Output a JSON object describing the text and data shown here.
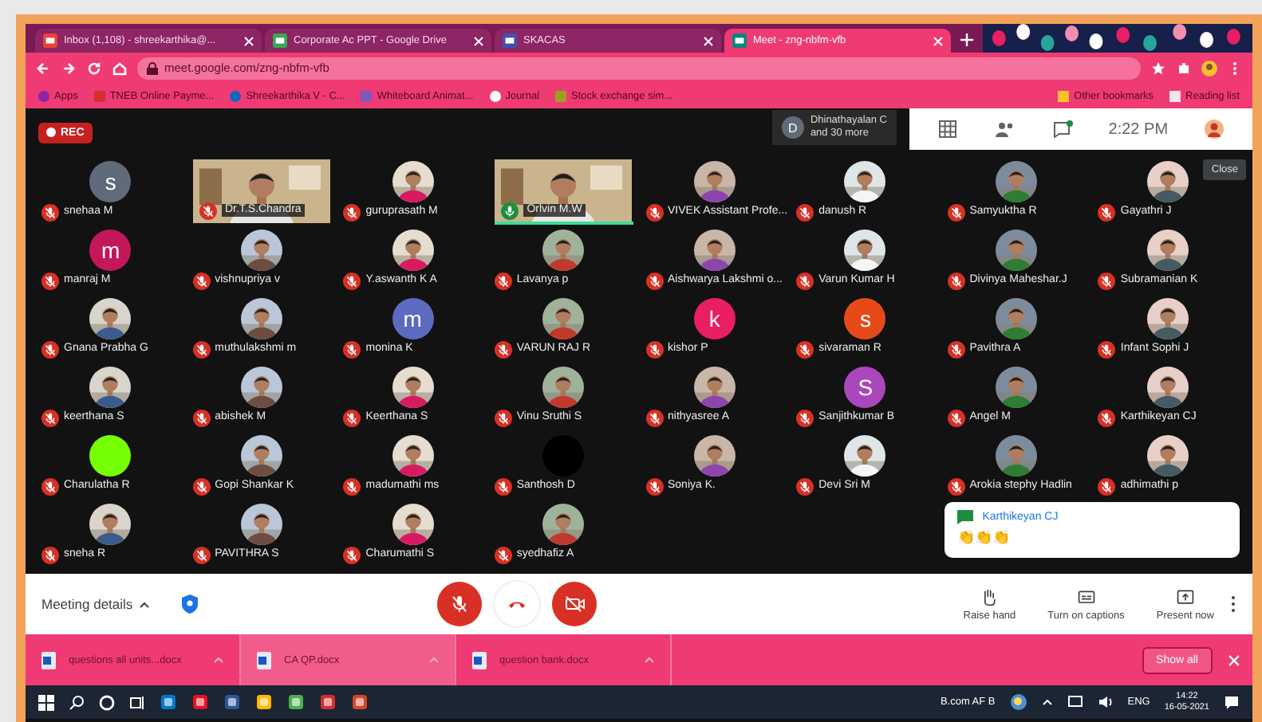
{
  "browser": {
    "tabs": [
      {
        "title": "Inbox (1,108) - shreekarthika@...",
        "selected": false
      },
      {
        "title": "Corporate Ac PPT - Google Drive",
        "selected": false
      },
      {
        "title": "SKACAS",
        "selected": false
      },
      {
        "title": "Meet - zng-nbfm-vfb",
        "selected": true
      }
    ],
    "address": "meet.google.com/zng-nbfm-vfb",
    "bookmarks": [
      "Apps",
      "TNEB Online Payme...",
      "Shreekarthika V - C...",
      "Whiteboard Animat...",
      "Journal",
      "Stock exchange sim..."
    ],
    "bookmarks_right": [
      "Other bookmarks",
      "Reading list"
    ]
  },
  "meeting": {
    "recording_badge": "REC",
    "presenter": {
      "initial": "D",
      "name": "Dhinathayalan C",
      "more": "and 30 more"
    },
    "time": "2:22 PM",
    "tooltip": "Close",
    "participants": [
      {
        "name": "snehaa M",
        "kind": "letter",
        "letter": "s",
        "color": "#5f6b78",
        "muted": true,
        "speaking": false
      },
      {
        "name": "Dr.T.S.Chandra",
        "kind": "video",
        "muted": true,
        "speaking": false
      },
      {
        "name": "guruprasath M",
        "kind": "picture",
        "muted": true,
        "speaking": false
      },
      {
        "name": "Orlvin M.W",
        "kind": "video",
        "muted": false,
        "speaking": true
      },
      {
        "name": "VIVEK Assistant Profe...",
        "kind": "picture",
        "muted": true,
        "speaking": false
      },
      {
        "name": "danush R",
        "kind": "picture",
        "muted": true,
        "speaking": false
      },
      {
        "name": "Samyuktha R",
        "kind": "picture",
        "muted": true,
        "speaking": false
      },
      {
        "name": "Gayathri J",
        "kind": "picture",
        "muted": true,
        "speaking": false
      },
      {
        "name": "manraj M",
        "kind": "letter",
        "letter": "m",
        "color": "#c2185b",
        "muted": true,
        "speaking": false
      },
      {
        "name": "vishnupriya v",
        "kind": "picture",
        "muted": true,
        "speaking": false
      },
      {
        "name": "Y.aswanth K A",
        "kind": "picture",
        "muted": true,
        "speaking": false
      },
      {
        "name": "Lavanya p",
        "kind": "picture",
        "muted": true,
        "speaking": false
      },
      {
        "name": "Aishwarya Lakshmi o...",
        "kind": "picture",
        "muted": true,
        "speaking": false
      },
      {
        "name": "Varun Kumar H",
        "kind": "picture",
        "muted": true,
        "speaking": false
      },
      {
        "name": "Divinya Maheshar.J",
        "kind": "picture",
        "muted": true,
        "speaking": false
      },
      {
        "name": "Subramanian K",
        "kind": "picture",
        "muted": true,
        "speaking": false
      },
      {
        "name": "Gnana Prabha G",
        "kind": "picture",
        "muted": true,
        "speaking": false
      },
      {
        "name": "muthulakshmi m",
        "kind": "picture",
        "muted": true,
        "speaking": false
      },
      {
        "name": "monina K",
        "kind": "letter",
        "letter": "m",
        "color": "#5c6bc0",
        "muted": true,
        "speaking": false
      },
      {
        "name": "VARUN RAJ R",
        "kind": "picture",
        "muted": true,
        "speaking": false
      },
      {
        "name": "kishor P",
        "kind": "letter",
        "letter": "k",
        "color": "#e91e63",
        "muted": true,
        "speaking": false
      },
      {
        "name": "sivaraman R",
        "kind": "letter",
        "letter": "s",
        "color": "#e64a19",
        "muted": true,
        "speaking": false
      },
      {
        "name": "Pavithra A",
        "kind": "picture",
        "muted": true,
        "speaking": false
      },
      {
        "name": "Infant Sophi J",
        "kind": "picture",
        "muted": true,
        "speaking": false
      },
      {
        "name": "keerthana S",
        "kind": "picture",
        "muted": true,
        "speaking": false
      },
      {
        "name": "abishek M",
        "kind": "picture",
        "muted": true,
        "speaking": false
      },
      {
        "name": "Keerthana S",
        "kind": "picture",
        "muted": true,
        "speaking": false
      },
      {
        "name": "Vinu Sruthi S",
        "kind": "picture",
        "muted": true,
        "speaking": false
      },
      {
        "name": "nithyasree A",
        "kind": "picture",
        "muted": true,
        "speaking": false
      },
      {
        "name": "Sanjithkumar B",
        "kind": "letter",
        "letter": "S",
        "color": "#ab47bc",
        "muted": true,
        "speaking": false
      },
      {
        "name": "Angel M",
        "kind": "picture",
        "muted": true,
        "speaking": false
      },
      {
        "name": "Karthikeyan CJ",
        "kind": "picture",
        "muted": true,
        "speaking": false
      },
      {
        "name": "Charulatha R",
        "kind": "plain",
        "color": "#76ff03",
        "muted": true,
        "speaking": false
      },
      {
        "name": "Gopi Shankar K",
        "kind": "picture",
        "muted": true,
        "speaking": false
      },
      {
        "name": "madumathi ms",
        "kind": "picture",
        "muted": true,
        "speaking": false
      },
      {
        "name": "Santhosh D",
        "kind": "plain",
        "color": "#000000",
        "muted": true,
        "speaking": false
      },
      {
        "name": "Soniya K.",
        "kind": "picture",
        "muted": true,
        "speaking": false
      },
      {
        "name": "Devi Sri M",
        "kind": "picture",
        "muted": true,
        "speaking": false
      },
      {
        "name": "Arokia stephy Hadlin",
        "kind": "picture",
        "muted": true,
        "speaking": false
      },
      {
        "name": "adhimathi p",
        "kind": "picture",
        "muted": true,
        "speaking": false
      },
      {
        "name": "sneha R",
        "kind": "picture",
        "muted": true,
        "speaking": false
      },
      {
        "name": "PAVITHRA S",
        "kind": "picture",
        "muted": true,
        "speaking": false
      },
      {
        "name": "Charumathi S",
        "kind": "picture",
        "muted": true,
        "speaking": false
      },
      {
        "name": "syedhafiz A",
        "kind": "picture",
        "muted": true,
        "speaking": false
      }
    ],
    "chat_popup": {
      "sender": "Karthikeyan CJ",
      "message": "👏👏👏"
    }
  },
  "controls": {
    "meeting_details": "Meeting details",
    "mic_on": false,
    "camera_on": false,
    "actions": [
      {
        "kind": "hand",
        "label": "Raise hand"
      },
      {
        "kind": "captions",
        "label": "Turn on captions"
      },
      {
        "kind": "present",
        "label": "Present now"
      }
    ]
  },
  "downloads": {
    "files": [
      "questions all units...docx",
      "CA QP.docx",
      "question bank.docx"
    ],
    "show_all": "Show all"
  },
  "taskbar": {
    "tray_text": "B.com AF B",
    "language": "ENG",
    "time": "14:22",
    "date": "16-05-2021"
  }
}
